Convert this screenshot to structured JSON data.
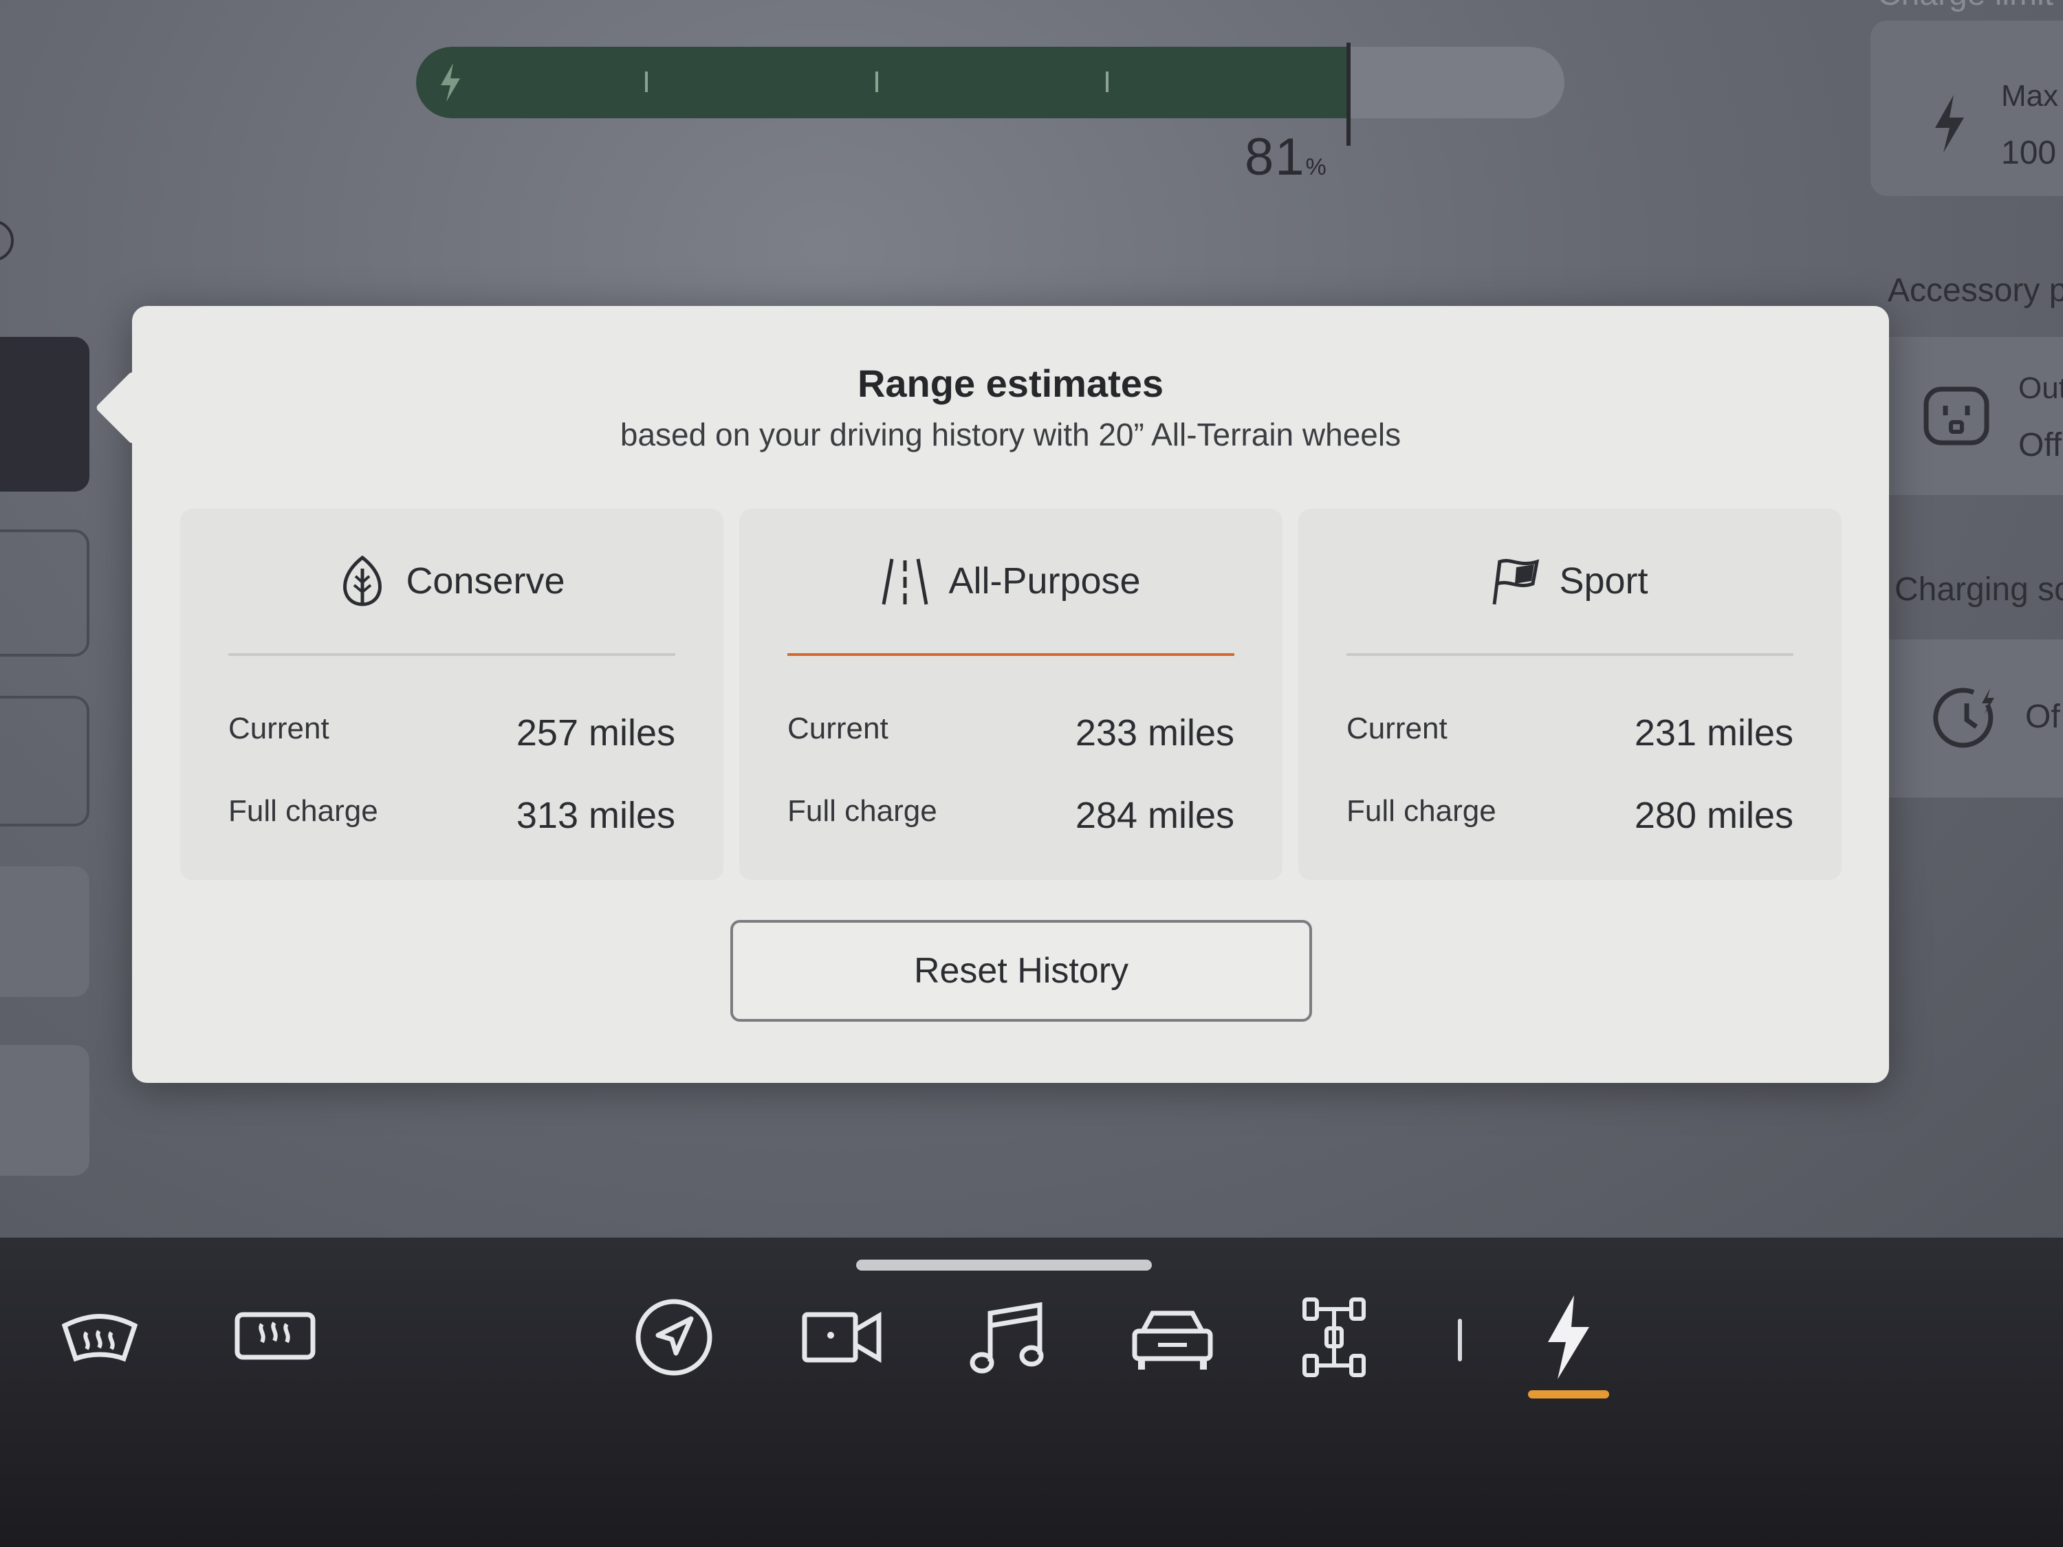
{
  "status": {
    "battery_percent_value": "81",
    "battery_percent_unit": "%",
    "charge_level": 0.81
  },
  "right_panel": {
    "charge_limit_label": "Charge limit",
    "charge_limit_title": "Max",
    "charge_limit_value": "100",
    "accessory_label": "Accessory p",
    "outlet_label": "Out",
    "outlet_value": "Off",
    "charging_schedule_label": "Charging sc",
    "schedule_value": "Of"
  },
  "modal": {
    "title": "Range estimates",
    "subtitle": "based on your driving history with 20” All-Terrain wheels",
    "modes": [
      {
        "name": "Conserve",
        "icon": "leaf-icon",
        "current_label": "Current",
        "current_value": "257 miles",
        "full_label": "Full charge",
        "full_value": "313 miles",
        "active": false
      },
      {
        "name": "All-Purpose",
        "icon": "road-icon",
        "current_label": "Current",
        "current_value": "233 miles",
        "full_label": "Full charge",
        "full_value": "284 miles",
        "active": true
      },
      {
        "name": "Sport",
        "icon": "flag-icon",
        "current_label": "Current",
        "current_value": "231 miles",
        "full_label": "Full charge",
        "full_value": "280 miles",
        "active": false
      }
    ],
    "reset_button": "Reset History"
  },
  "dock": {
    "items": [
      {
        "icon": "front-defrost-icon"
      },
      {
        "icon": "rear-defrost-icon"
      },
      {
        "icon": "navigation-icon"
      },
      {
        "icon": "camera-icon"
      },
      {
        "icon": "music-icon"
      },
      {
        "icon": "vehicle-icon"
      },
      {
        "icon": "drivetrain-icon"
      },
      {
        "icon": "charging-icon",
        "active": true
      }
    ]
  },
  "colors": {
    "accent": "#d66a2c",
    "dock_active": "#e59a34",
    "charge_fill": "#2f4a3c",
    "modal_bg": "#e9eae7"
  }
}
